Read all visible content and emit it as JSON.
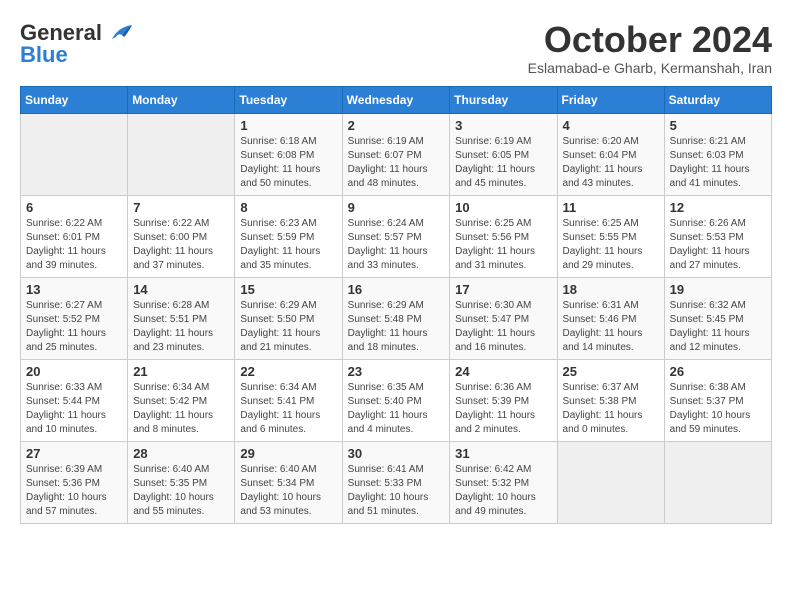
{
  "header": {
    "logo_general": "General",
    "logo_blue": "Blue",
    "month_title": "October 2024",
    "location": "Eslamabad-e Gharb, Kermanshah, Iran"
  },
  "days_of_week": [
    "Sunday",
    "Monday",
    "Tuesday",
    "Wednesday",
    "Thursday",
    "Friday",
    "Saturday"
  ],
  "weeks": [
    [
      {
        "day": "",
        "sunrise": "",
        "sunset": "",
        "daylight": ""
      },
      {
        "day": "",
        "sunrise": "",
        "sunset": "",
        "daylight": ""
      },
      {
        "day": "1",
        "sunrise": "Sunrise: 6:18 AM",
        "sunset": "Sunset: 6:08 PM",
        "daylight": "Daylight: 11 hours and 50 minutes."
      },
      {
        "day": "2",
        "sunrise": "Sunrise: 6:19 AM",
        "sunset": "Sunset: 6:07 PM",
        "daylight": "Daylight: 11 hours and 48 minutes."
      },
      {
        "day": "3",
        "sunrise": "Sunrise: 6:19 AM",
        "sunset": "Sunset: 6:05 PM",
        "daylight": "Daylight: 11 hours and 45 minutes."
      },
      {
        "day": "4",
        "sunrise": "Sunrise: 6:20 AM",
        "sunset": "Sunset: 6:04 PM",
        "daylight": "Daylight: 11 hours and 43 minutes."
      },
      {
        "day": "5",
        "sunrise": "Sunrise: 6:21 AM",
        "sunset": "Sunset: 6:03 PM",
        "daylight": "Daylight: 11 hours and 41 minutes."
      }
    ],
    [
      {
        "day": "6",
        "sunrise": "Sunrise: 6:22 AM",
        "sunset": "Sunset: 6:01 PM",
        "daylight": "Daylight: 11 hours and 39 minutes."
      },
      {
        "day": "7",
        "sunrise": "Sunrise: 6:22 AM",
        "sunset": "Sunset: 6:00 PM",
        "daylight": "Daylight: 11 hours and 37 minutes."
      },
      {
        "day": "8",
        "sunrise": "Sunrise: 6:23 AM",
        "sunset": "Sunset: 5:59 PM",
        "daylight": "Daylight: 11 hours and 35 minutes."
      },
      {
        "day": "9",
        "sunrise": "Sunrise: 6:24 AM",
        "sunset": "Sunset: 5:57 PM",
        "daylight": "Daylight: 11 hours and 33 minutes."
      },
      {
        "day": "10",
        "sunrise": "Sunrise: 6:25 AM",
        "sunset": "Sunset: 5:56 PM",
        "daylight": "Daylight: 11 hours and 31 minutes."
      },
      {
        "day": "11",
        "sunrise": "Sunrise: 6:25 AM",
        "sunset": "Sunset: 5:55 PM",
        "daylight": "Daylight: 11 hours and 29 minutes."
      },
      {
        "day": "12",
        "sunrise": "Sunrise: 6:26 AM",
        "sunset": "Sunset: 5:53 PM",
        "daylight": "Daylight: 11 hours and 27 minutes."
      }
    ],
    [
      {
        "day": "13",
        "sunrise": "Sunrise: 6:27 AM",
        "sunset": "Sunset: 5:52 PM",
        "daylight": "Daylight: 11 hours and 25 minutes."
      },
      {
        "day": "14",
        "sunrise": "Sunrise: 6:28 AM",
        "sunset": "Sunset: 5:51 PM",
        "daylight": "Daylight: 11 hours and 23 minutes."
      },
      {
        "day": "15",
        "sunrise": "Sunrise: 6:29 AM",
        "sunset": "Sunset: 5:50 PM",
        "daylight": "Daylight: 11 hours and 21 minutes."
      },
      {
        "day": "16",
        "sunrise": "Sunrise: 6:29 AM",
        "sunset": "Sunset: 5:48 PM",
        "daylight": "Daylight: 11 hours and 18 minutes."
      },
      {
        "day": "17",
        "sunrise": "Sunrise: 6:30 AM",
        "sunset": "Sunset: 5:47 PM",
        "daylight": "Daylight: 11 hours and 16 minutes."
      },
      {
        "day": "18",
        "sunrise": "Sunrise: 6:31 AM",
        "sunset": "Sunset: 5:46 PM",
        "daylight": "Daylight: 11 hours and 14 minutes."
      },
      {
        "day": "19",
        "sunrise": "Sunrise: 6:32 AM",
        "sunset": "Sunset: 5:45 PM",
        "daylight": "Daylight: 11 hours and 12 minutes."
      }
    ],
    [
      {
        "day": "20",
        "sunrise": "Sunrise: 6:33 AM",
        "sunset": "Sunset: 5:44 PM",
        "daylight": "Daylight: 11 hours and 10 minutes."
      },
      {
        "day": "21",
        "sunrise": "Sunrise: 6:34 AM",
        "sunset": "Sunset: 5:42 PM",
        "daylight": "Daylight: 11 hours and 8 minutes."
      },
      {
        "day": "22",
        "sunrise": "Sunrise: 6:34 AM",
        "sunset": "Sunset: 5:41 PM",
        "daylight": "Daylight: 11 hours and 6 minutes."
      },
      {
        "day": "23",
        "sunrise": "Sunrise: 6:35 AM",
        "sunset": "Sunset: 5:40 PM",
        "daylight": "Daylight: 11 hours and 4 minutes."
      },
      {
        "day": "24",
        "sunrise": "Sunrise: 6:36 AM",
        "sunset": "Sunset: 5:39 PM",
        "daylight": "Daylight: 11 hours and 2 minutes."
      },
      {
        "day": "25",
        "sunrise": "Sunrise: 6:37 AM",
        "sunset": "Sunset: 5:38 PM",
        "daylight": "Daylight: 11 hours and 0 minutes."
      },
      {
        "day": "26",
        "sunrise": "Sunrise: 6:38 AM",
        "sunset": "Sunset: 5:37 PM",
        "daylight": "Daylight: 10 hours and 59 minutes."
      }
    ],
    [
      {
        "day": "27",
        "sunrise": "Sunrise: 6:39 AM",
        "sunset": "Sunset: 5:36 PM",
        "daylight": "Daylight: 10 hours and 57 minutes."
      },
      {
        "day": "28",
        "sunrise": "Sunrise: 6:40 AM",
        "sunset": "Sunset: 5:35 PM",
        "daylight": "Daylight: 10 hours and 55 minutes."
      },
      {
        "day": "29",
        "sunrise": "Sunrise: 6:40 AM",
        "sunset": "Sunset: 5:34 PM",
        "daylight": "Daylight: 10 hours and 53 minutes."
      },
      {
        "day": "30",
        "sunrise": "Sunrise: 6:41 AM",
        "sunset": "Sunset: 5:33 PM",
        "daylight": "Daylight: 10 hours and 51 minutes."
      },
      {
        "day": "31",
        "sunrise": "Sunrise: 6:42 AM",
        "sunset": "Sunset: 5:32 PM",
        "daylight": "Daylight: 10 hours and 49 minutes."
      },
      {
        "day": "",
        "sunrise": "",
        "sunset": "",
        "daylight": ""
      },
      {
        "day": "",
        "sunrise": "",
        "sunset": "",
        "daylight": ""
      }
    ]
  ]
}
